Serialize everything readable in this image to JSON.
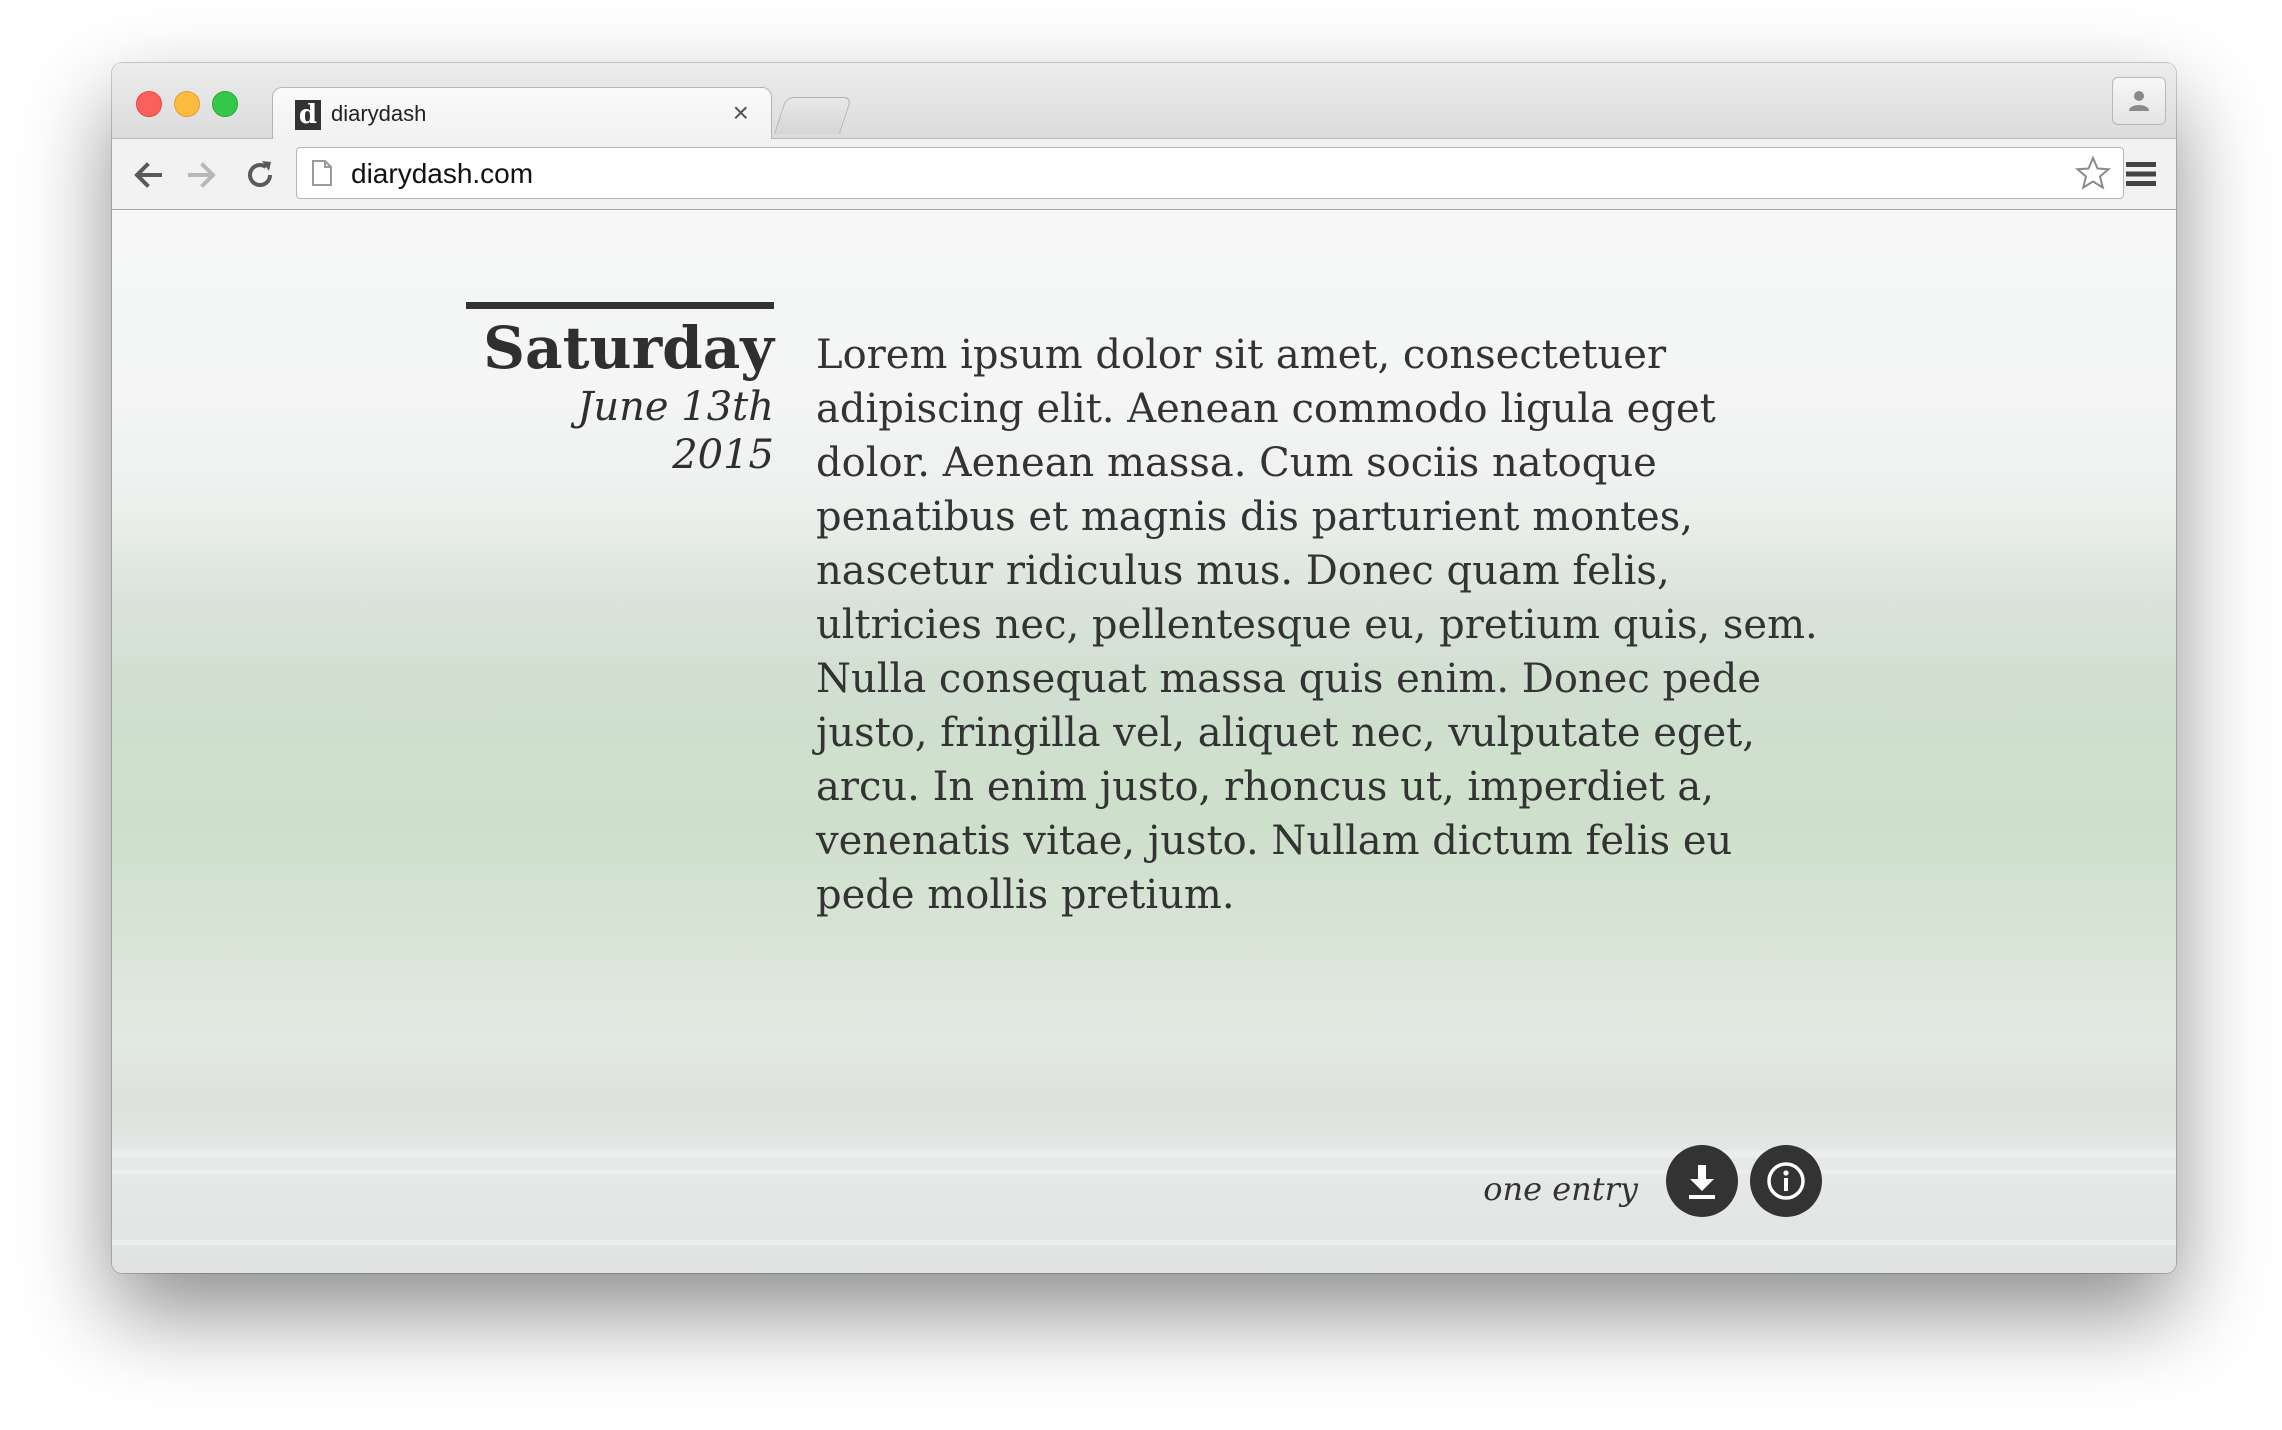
{
  "tab": {
    "title": "diarydash",
    "favicon_letter": "d",
    "close_glyph": "×"
  },
  "address_bar": {
    "url": "diarydash.com"
  },
  "entry": {
    "day": "Saturday",
    "date": "June 13th 2015",
    "body": "Lorem ipsum dolor sit amet, consectetuer adipiscing elit. Aenean commodo ligula eget dolor. Aenean massa. Cum sociis natoque penatibus et magnis dis parturient montes, nascetur ridiculus mus. Donec quam felis, ultricies nec, pellentesque eu, pretium quis, sem. Nulla consequat massa quis enim. Donec pede justo, fringilla vel, aliquet nec, vulputate eget, arcu. In enim justo, rhoncus ut, imperdiet a, venenatis vitae, justo. Nullam dictum felis eu pede mollis pretium."
  },
  "footer": {
    "status": "one entry",
    "download_icon": "download-icon",
    "info_icon": "info-icon"
  },
  "colors": {
    "ink": "#333333",
    "traffic_red": "#fc605c",
    "traffic_yellow": "#fdbc40",
    "traffic_green": "#34c84a"
  }
}
